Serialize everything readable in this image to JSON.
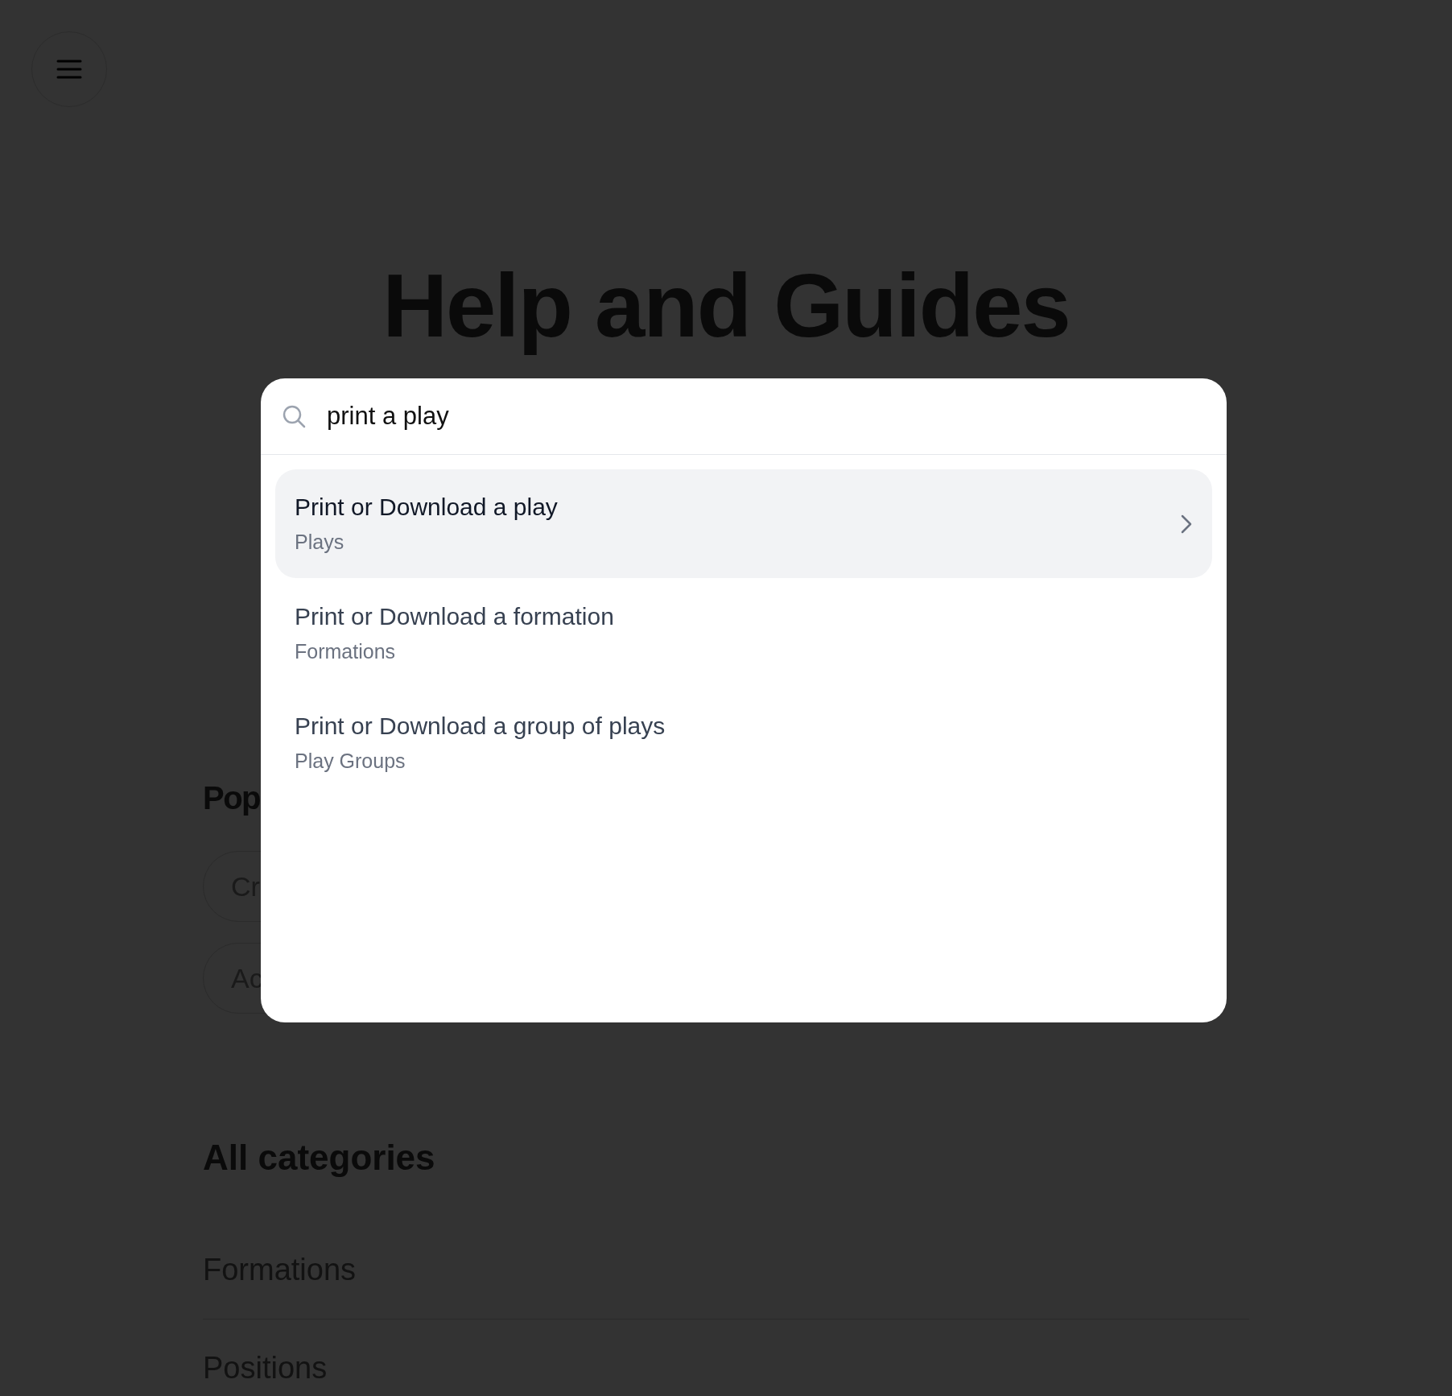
{
  "page": {
    "title": "Help and Guides",
    "popular_heading": "Pop",
    "popular_chips": [
      "Cr",
      "Ac"
    ],
    "categories_heading": "All categories",
    "categories": [
      "Formations",
      "Positions"
    ]
  },
  "search_dialog": {
    "query": "print a play",
    "results": [
      {
        "title": "Print or Download a play",
        "category": "Plays",
        "selected": true
      },
      {
        "title": "Print or Download a formation",
        "category": "Formations",
        "selected": false
      },
      {
        "title": "Print or Download a group of plays",
        "category": "Play Groups",
        "selected": false
      }
    ]
  }
}
